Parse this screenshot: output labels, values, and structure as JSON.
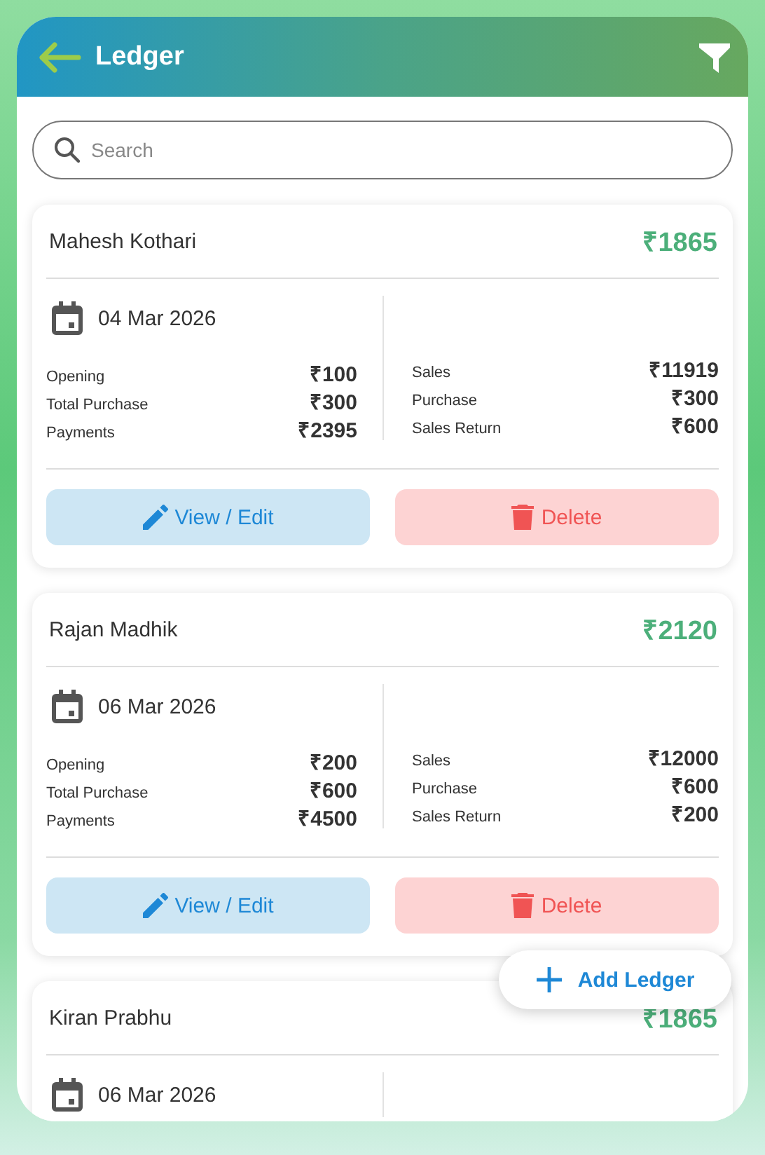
{
  "header": {
    "title": "Ledger"
  },
  "search": {
    "placeholder": "Search"
  },
  "ledgers": [
    {
      "name": "Mahesh Kothari",
      "balance": "₹1865",
      "date": "04 Mar 2026",
      "left": [
        {
          "label": "Opening",
          "value": "₹100"
        },
        {
          "label": "Total Purchase",
          "value": "₹300"
        },
        {
          "label": "Payments",
          "value": "₹2395"
        }
      ],
      "right": [
        {
          "label": "Sales",
          "value": "₹11919"
        },
        {
          "label": "Purchase",
          "value": "₹300"
        },
        {
          "label": "Sales Return",
          "value": "₹600"
        }
      ],
      "actions": [
        "View / Edit",
        "Delete"
      ]
    },
    {
      "name": "Rajan Madhik",
      "balance": "₹2120",
      "date": "06 Mar 2026",
      "left": [
        {
          "label": "Opening",
          "value": "₹200"
        },
        {
          "label": "Total Purchase",
          "value": "₹600"
        },
        {
          "label": "Payments",
          "value": "₹4500"
        }
      ],
      "right": [
        {
          "label": "Sales",
          "value": "₹12000"
        },
        {
          "label": "Purchase",
          "value": "₹600"
        },
        {
          "label": "Sales Return",
          "value": "₹200"
        }
      ],
      "actions": [
        "View / Edit",
        "Delete"
      ]
    },
    {
      "name": "Kiran Prabhu",
      "balance": "₹1865",
      "date": "06 Mar 2026"
    }
  ],
  "fab": {
    "label": "Add Ledger"
  }
}
